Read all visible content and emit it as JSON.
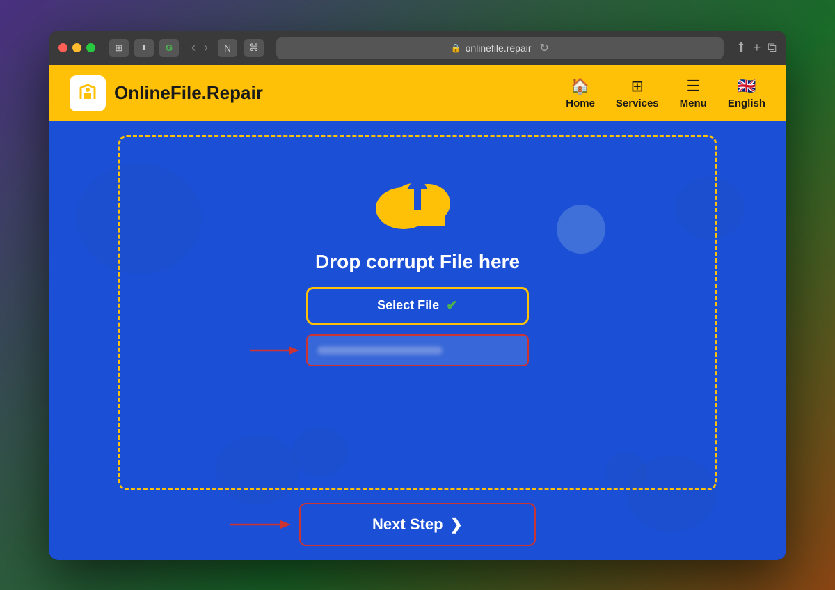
{
  "browser": {
    "address": "onlinefile.repair",
    "traffic_lights": [
      "red",
      "yellow",
      "green"
    ]
  },
  "header": {
    "logo_text": "OnlineFile.Repair",
    "nav": [
      {
        "id": "home",
        "label": "Home",
        "icon": "🏠"
      },
      {
        "id": "services",
        "label": "Services",
        "icon": "⊞"
      },
      {
        "id": "menu",
        "label": "Menu",
        "icon": "≡"
      },
      {
        "id": "english",
        "label": "English",
        "icon": "🇬🇧"
      }
    ]
  },
  "main": {
    "drop_text": "Drop corrupt File here",
    "select_file_label": "Select File",
    "checkmark": "✔",
    "next_step_label": "Next Step",
    "next_step_chevron": "❯"
  }
}
